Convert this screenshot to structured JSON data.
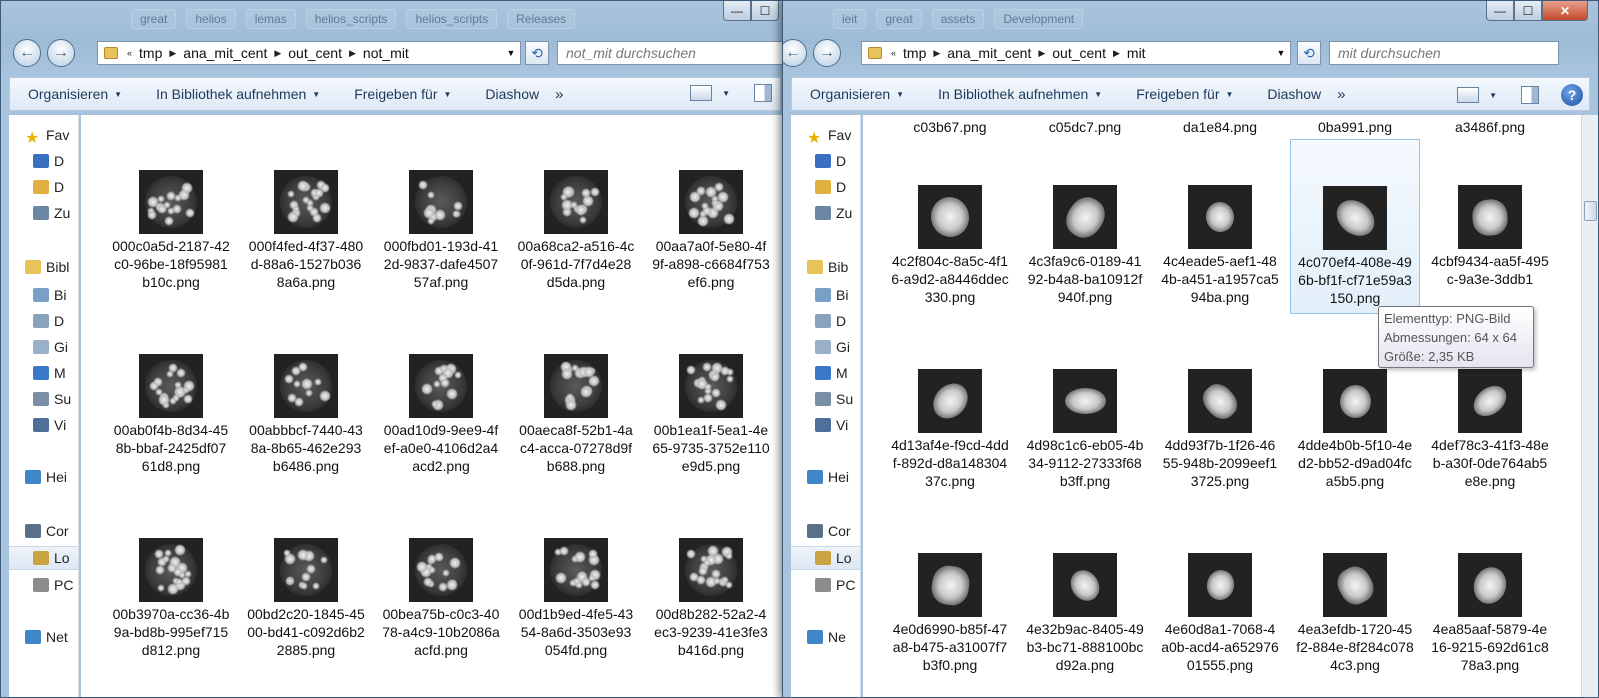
{
  "left_window": {
    "ghost_tabs": [
      "great",
      "helios",
      "lemas",
      "helios_scripts",
      "helios_scripts",
      "Releases"
    ],
    "breadcrumb": [
      "tmp",
      "ana_mit_cent",
      "out_cent",
      "not_mit"
    ],
    "search_placeholder": "not_mit durchsuchen",
    "toolbar": {
      "organize": "Organisieren",
      "library": "In Bibliothek aufnehmen",
      "share": "Freigeben für",
      "slideshow": "Diashow",
      "more": "»"
    },
    "nav_items": [
      "Fav",
      "D",
      "D",
      "Zu",
      "Bibl",
      "Bi",
      "D",
      "Gi",
      "M",
      "Su",
      "Vi",
      "Hei",
      "Cor",
      "Lo",
      "PC",
      "Net"
    ],
    "files": [
      "000c0a5d-2187-42c0-96be-18f95981b10c.png",
      "000f4fed-4f37-480d-88a6-1527b0368a6a.png",
      "000fbd01-193d-412d-9837-dafe450757af.png",
      "00a68ca2-a516-4c0f-961d-7f7d4e28d5da.png",
      "00aa7a0f-5e80-4f9f-a898-c6684f753ef6.png",
      "00ab0f4b-8d34-458b-bbaf-2425df0761d8.png",
      "00abbbcf-7440-438a-8b65-462e293b6486.png",
      "00ad10d9-9ee9-4fef-a0e0-4106d2a4acd2.png",
      "00aeca8f-52b1-4ac4-acca-07278d9fb688.png",
      "00b1ea1f-5ea1-4e65-9735-3752e110e9d5.png",
      "00b3970a-cc36-4b9a-bd8b-995ef715d812.png",
      "00bd2c20-1845-4500-bd41-c092d6b22885.png",
      "00bea75b-c0c3-4078-a4c9-10b2086aacfd.png",
      "00d1b9ed-4fe5-4354-8a6d-3503e93054fd.png",
      "00d8b282-52a2-4ec3-9239-41e3fe3b416d.png"
    ]
  },
  "right_window": {
    "ghost_tabs": [
      "ieit",
      "great",
      "assets",
      "Development"
    ],
    "breadcrumb": [
      "tmp",
      "ana_mit_cent",
      "out_cent",
      "mit"
    ],
    "search_placeholder": "mit durchsuchen",
    "toolbar": {
      "organize": "Organisieren",
      "library": "In Bibliothek aufnehmen",
      "share": "Freigeben für",
      "slideshow": "Diashow",
      "more": "»"
    },
    "nav_items": [
      "Fav",
      "D",
      "D",
      "Zu",
      "Bib",
      "Bi",
      "D",
      "Gi",
      "M",
      "Su",
      "Vi",
      "Hei",
      "Cor",
      "Lo",
      "PC",
      "Ne"
    ],
    "top_partial": [
      "c03b67.png",
      "c05dc7.png",
      "da1e84.png",
      "0ba991.png",
      "a3486f.png"
    ],
    "files": [
      "4c2f804c-8a5c-4f16-a9d2-a8446ddec330.png",
      "4c3fa9c6-0189-4192-b4a8-ba10912f940f.png",
      "4c4eade5-aef1-484b-a451-a1957ca594ba.png",
      "4c070ef4-408e-496b-bf1f-cf71e59a3150.png",
      "4cbf9434-aa5f-495c-9a3e-3ddb1",
      "4d13af4e-f9cd-4ddf-892d-d8a14830437c.png",
      "4d98c1c6-eb05-4b34-9112-27333f68b3ff.png",
      "4dd93f7b-1f26-4655-948b-2099eef13725.png",
      "4dde4b0b-5f10-4ed2-bb52-d9ad04fca5b5.png",
      "4def78c3-41f3-48eb-a30f-0de764ab5e8e.png",
      "4e0d6990-b85f-47a8-b475-a31007f7b3f0.png",
      "4e32b9ac-8405-49b3-bc71-888100bcd92a.png",
      "4e60d8a1-7068-4a0b-acd4-a65297601555.png",
      "4ea3efdb-1720-45f2-884e-8f284c0784c3.png",
      "4ea85aaf-5879-4e16-9215-692d61c878a3.png"
    ],
    "selected_index": 3
  },
  "tooltip": {
    "line1": "Elementtyp: PNG-Bild",
    "line2": "Abmessungen: 64 x 64",
    "line3": "Größe: 2,35 KB"
  },
  "caption_buttons": {
    "min": "—",
    "max": "☐",
    "close": "✕"
  },
  "icons": {
    "back": "arrow-left",
    "forward": "arrow-right",
    "refresh": "refresh",
    "help": "help",
    "star": "star",
    "folder": "folder"
  }
}
